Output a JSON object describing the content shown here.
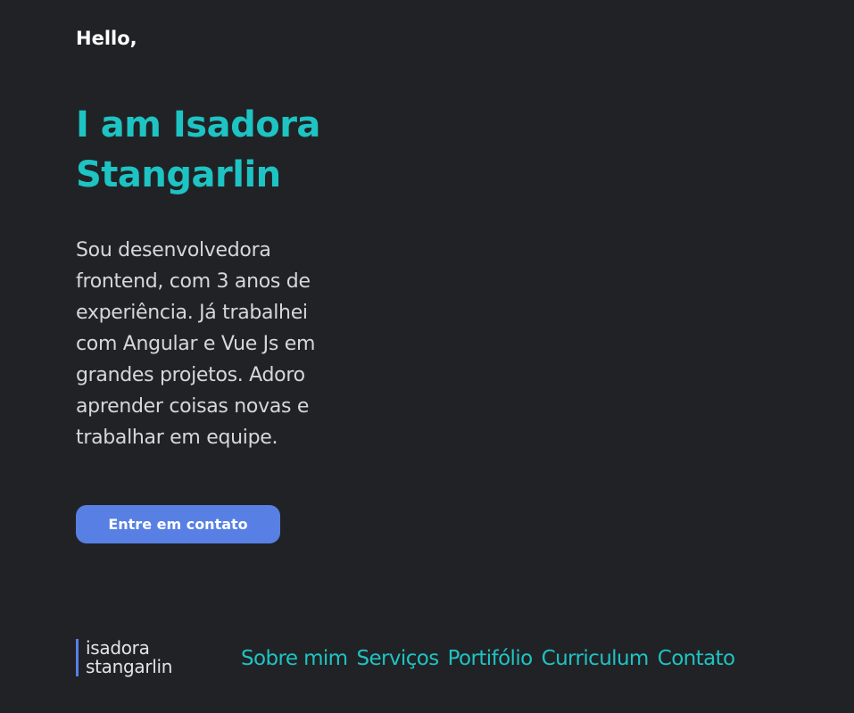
{
  "hero": {
    "greeting": "Hello,",
    "headline": "I am Isadora Stangarlin",
    "bio": "Sou desenvolvedora frontend, com 3 anos de experiência. Já trabalhei com Angular e Vue Js em grandes projetos. Adoro aprender coisas novas e trabalhar em equipe.",
    "cta_label": "Entre em contato"
  },
  "footer": {
    "logo": {
      "line1": "isadora",
      "line2": "stangarlin"
    },
    "nav": [
      {
        "label": "Sobre mim"
      },
      {
        "label": "Serviços"
      },
      {
        "label": "Portifólio"
      },
      {
        "label": "Curriculum"
      },
      {
        "label": "Contato"
      }
    ]
  },
  "colors": {
    "background": "#212225",
    "accent_teal": "#1ec3c3",
    "button_blue": "#5880e4",
    "text_white": "#ffffff",
    "text_light": "#d7d7d9"
  }
}
